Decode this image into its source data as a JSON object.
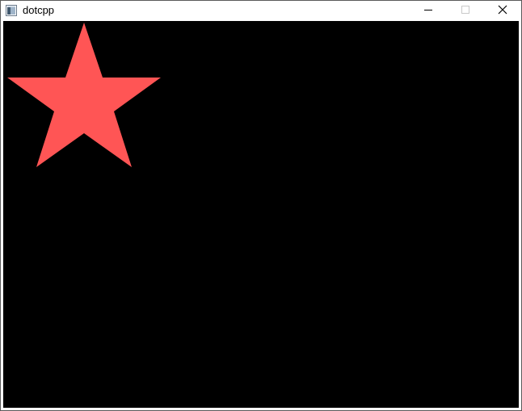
{
  "window": {
    "title": "dotcpp"
  },
  "controls": {
    "minimize_icon": "minimize-icon",
    "maximize_icon": "maximize-icon",
    "close_icon": "close-icon"
  },
  "canvas": {
    "background_color": "#000000",
    "star": {
      "fill_color": "#ff5555",
      "shape": "five-pointed-star"
    }
  }
}
